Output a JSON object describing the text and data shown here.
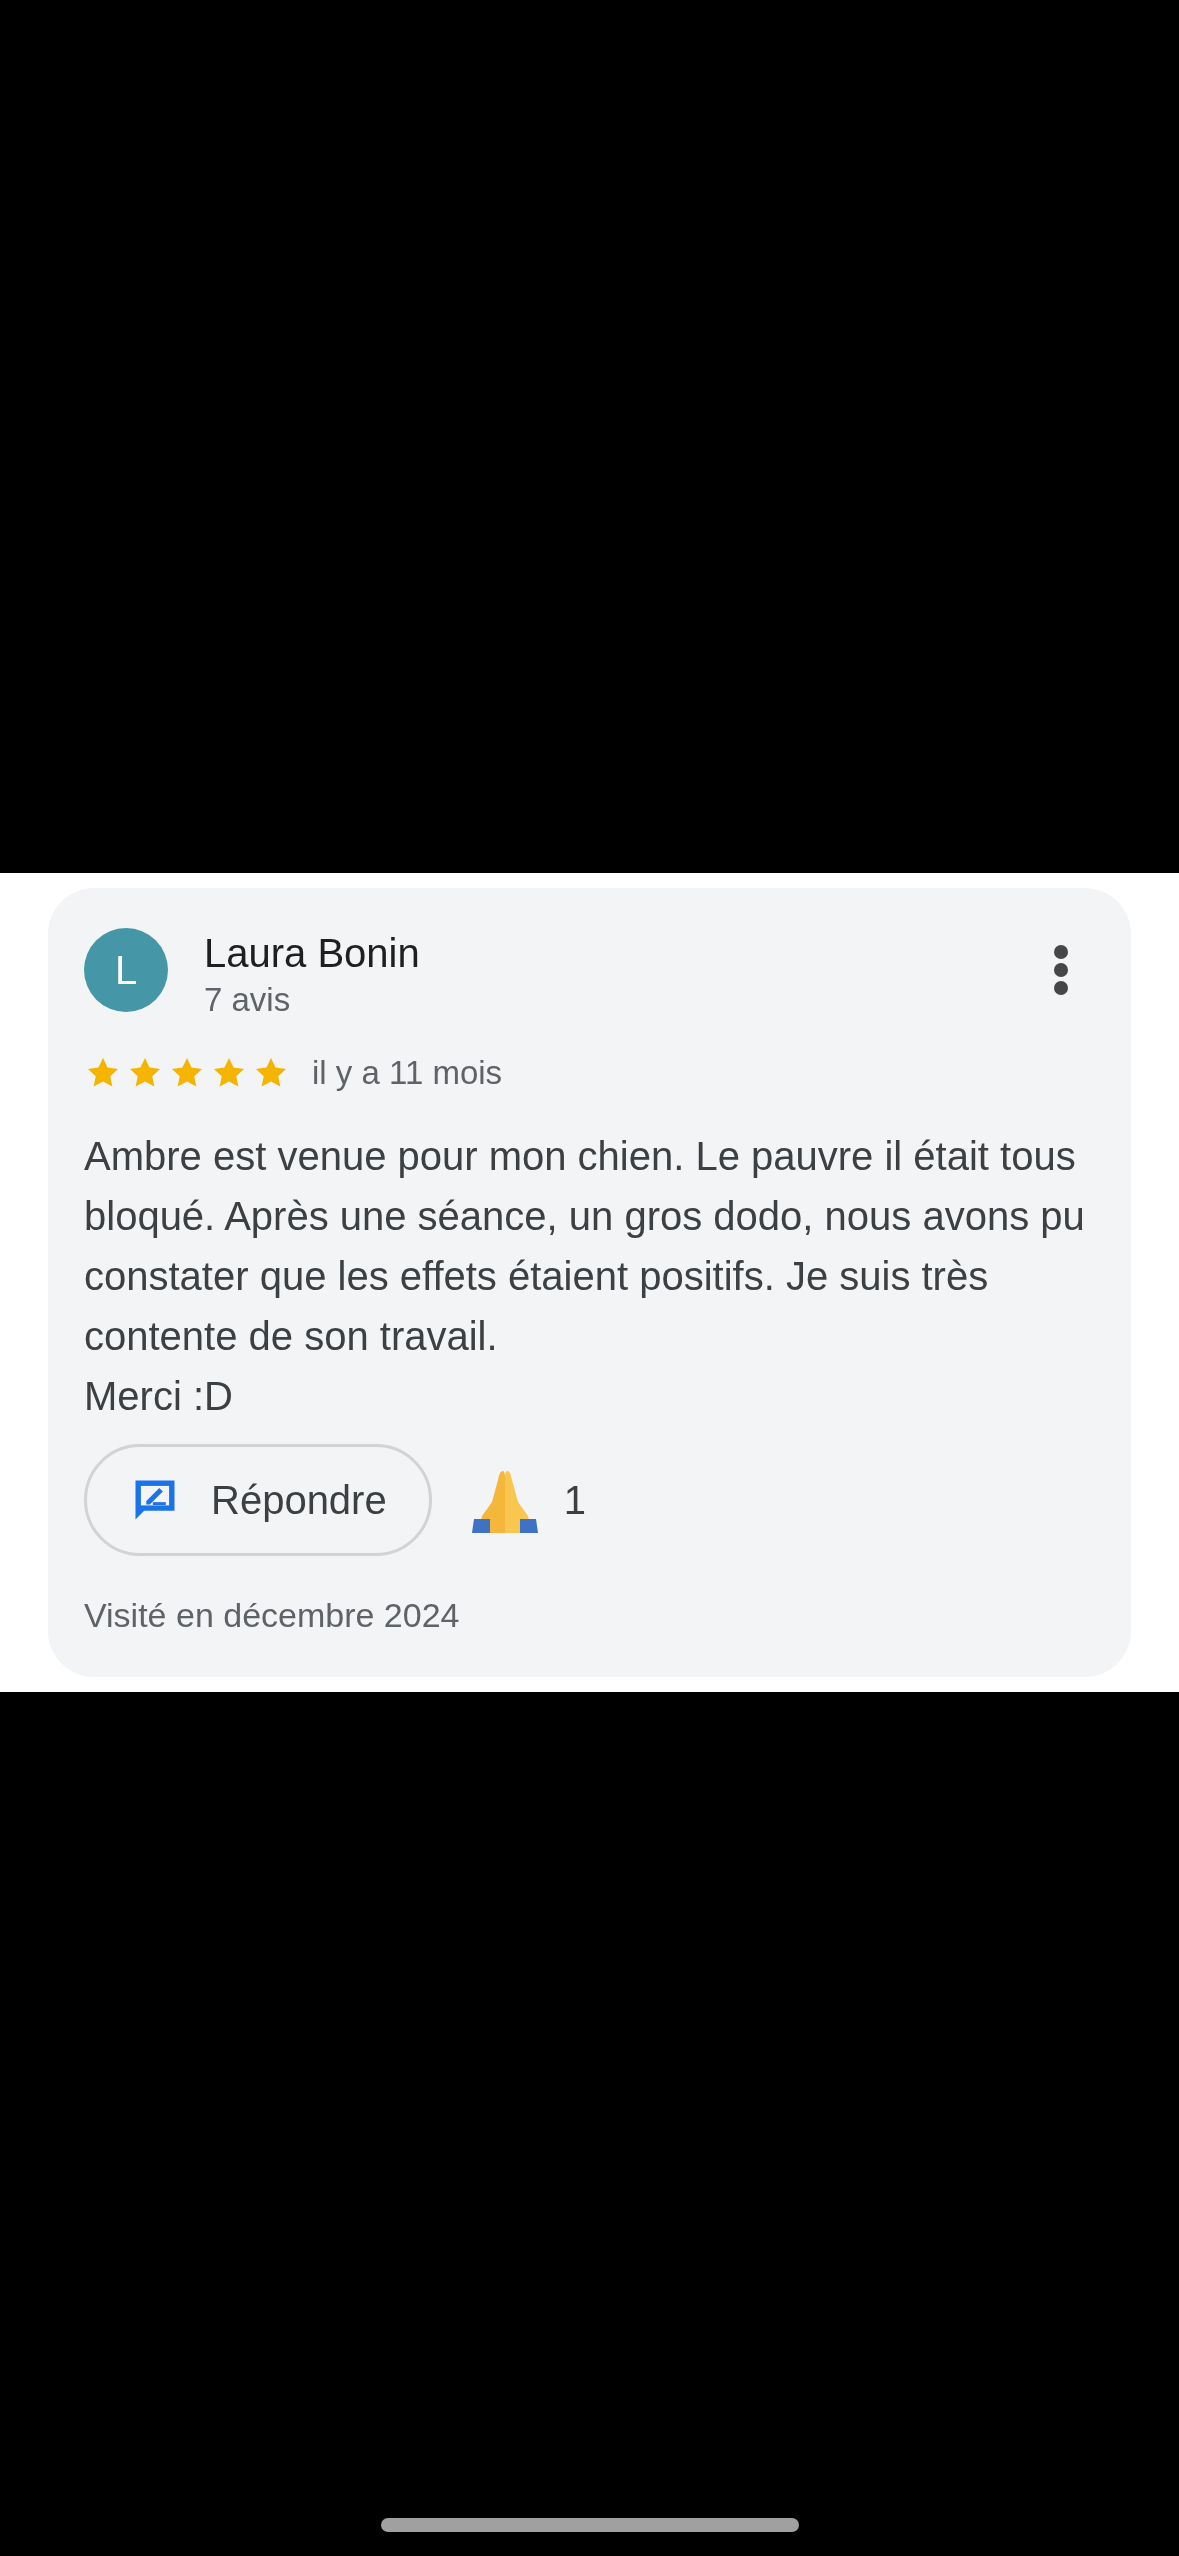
{
  "review": {
    "avatar_letter": "L",
    "author": "Laura Bonin",
    "review_count": "7 avis",
    "stars": 5,
    "time": "il y a 11 mois",
    "body": [
      "Ambre est venue pour mon chien. Le pauvre il était tous bloqué. Après une séance, un gros dodo, nous avons pu constater que les effets étaient positifs. Je suis très contente de son travail.",
      "Merci :D"
    ],
    "reply_button": "Répondre",
    "reaction_count": "1",
    "visit": "Visité en décembre 2024"
  }
}
